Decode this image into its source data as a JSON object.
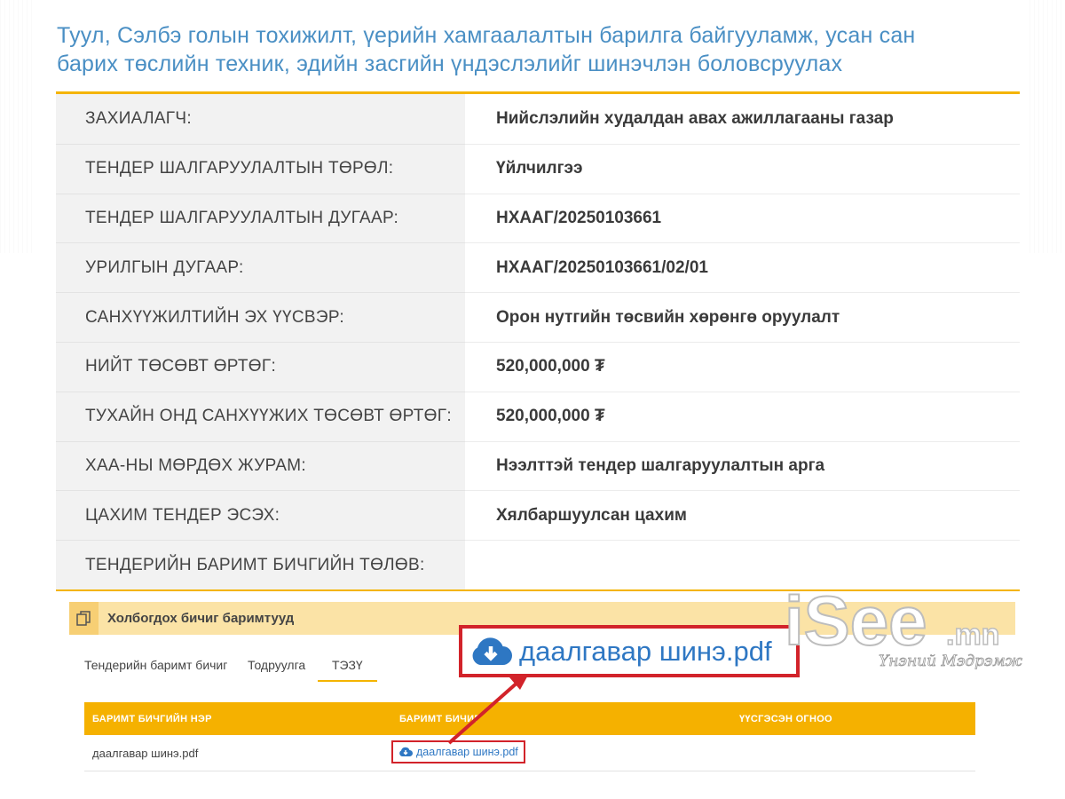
{
  "title": "Туул, Сэлбэ голын тохижилт, үерийн хамгаалалтын барилга байгууламж, усан сан барих төслийн техник, эдийн засгийн үндэслэлийг шинэчлэн боловсруулах",
  "details": [
    {
      "label": "ЗАХИАЛАГЧ:",
      "value": "Нийслэлийн худалдан авах ажиллагааны газар"
    },
    {
      "label": "ТЕНДЕР ШАЛГАРУУЛАЛТЫН ТӨРӨЛ:",
      "value": "Үйлчилгээ"
    },
    {
      "label": "ТЕНДЕР ШАЛГАРУУЛАЛТЫН ДУГААР:",
      "value": "НХААГ/20250103661"
    },
    {
      "label": "УРИЛГЫН ДУГААР:",
      "value": "НХААГ/20250103661/02/01"
    },
    {
      "label": "САНХҮҮЖИЛТИЙН ЭХ ҮҮСВЭР:",
      "value": "Орон нутгийн төсвийн хөрөнгө оруулалт"
    },
    {
      "label": "НИЙТ ТӨСӨВТ ӨРТӨГ:",
      "value": "520,000,000 ₮"
    },
    {
      "label": "ТУХАЙН ОНД САНХҮҮЖИХ ТӨСӨВТ ӨРТӨГ:",
      "value": "520,000,000 ₮"
    },
    {
      "label": "ХАА-НЫ МӨРДӨХ ЖУРАМ:",
      "value": "Нээлттэй тендер шалгаруулалтын арга"
    },
    {
      "label": "ЦАХИМ ТЕНДЕР ЭСЭХ:",
      "value": "Хялбаршуулсан цахим"
    },
    {
      "label": "ТЕНДЕРИЙН БАРИМТ БИЧГИЙН ТӨЛӨВ:",
      "value": ""
    }
  ],
  "docs_section": {
    "label": "Холбогдох бичиг баримтууд",
    "icon": "documents-icon",
    "tabs": [
      "Тендерийн баримт бичиг",
      "Тодруулга",
      "ТЭЗҮ"
    ],
    "active_tab": "ТЭЗҮ",
    "columns": [
      "БАРИМТ БИЧГИЙН НЭР",
      "БАРИМТ БИЧИГ",
      "ҮҮСГЭСЭН ОГНОО"
    ],
    "rows": [
      {
        "name": "даалгавар шинэ.pdf",
        "file": "даалгавар шинэ.pdf",
        "date": ""
      }
    ]
  },
  "callout": {
    "text": "даалгавар шинэ.pdf",
    "icon": "cloud-download-icon"
  },
  "watermark": {
    "brand": "iSee.mn",
    "tagline": "Үнэний Мэдрэмж"
  },
  "colors": {
    "title": "#4a8fc4",
    "accent": "#f4b400",
    "highlight": "#d2232a",
    "link": "#2e77c3"
  }
}
